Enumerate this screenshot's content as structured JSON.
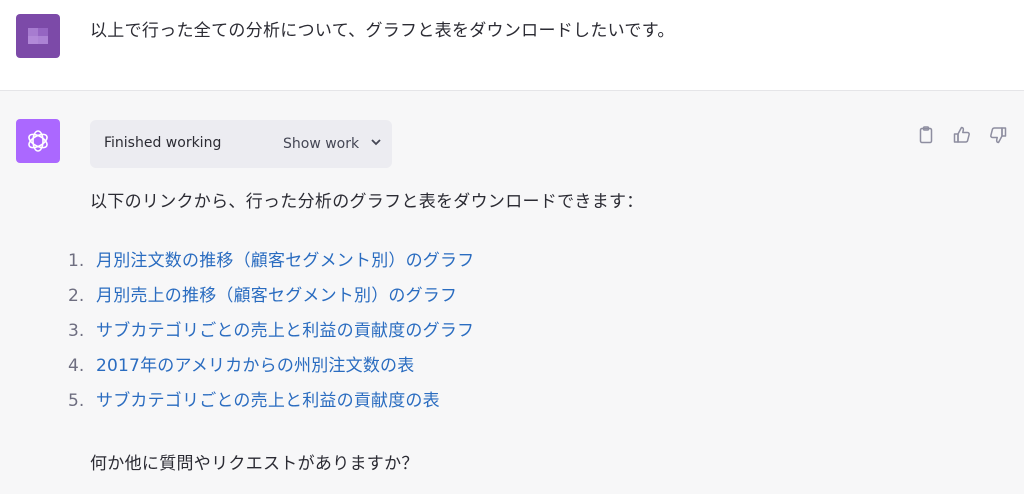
{
  "user_message": {
    "text": "以上で行った全ての分析について、グラフと表をダウンロードしたいです。"
  },
  "assistant_message": {
    "work_status": "Finished working",
    "show_work_label": "Show work",
    "intro": "以下のリンクから、行った分析のグラフと表をダウンロードできます：",
    "links": [
      {
        "num": "1.",
        "label": "月別注文数の推移（顧客セグメント別）のグラフ"
      },
      {
        "num": "2.",
        "label": "月別売上の推移（顧客セグメント別）のグラフ"
      },
      {
        "num": "3.",
        "label": "サブカテゴリごとの売上と利益の貢献度のグラフ"
      },
      {
        "num": "4.",
        "label": "2017年のアメリカからの州別注文数の表"
      },
      {
        "num": "5.",
        "label": "サブカテゴリごとの売上と利益の貢献度の表"
      }
    ],
    "outro": "何か他に質問やリクエストがありますか？"
  },
  "icons": {
    "user_avatar": "user-avatar",
    "ai_avatar": "openai-logo-icon",
    "copy": "clipboard-icon",
    "like": "thumbs-up-icon",
    "dislike": "thumbs-down-icon",
    "expand": "chevron-down-icon"
  },
  "colors": {
    "ai_avatar_bg": "#ab68ff",
    "user_avatar_bg": "#7c4aa8",
    "link": "#2a6cc0",
    "assistant_bg": "#f7f7f8"
  }
}
